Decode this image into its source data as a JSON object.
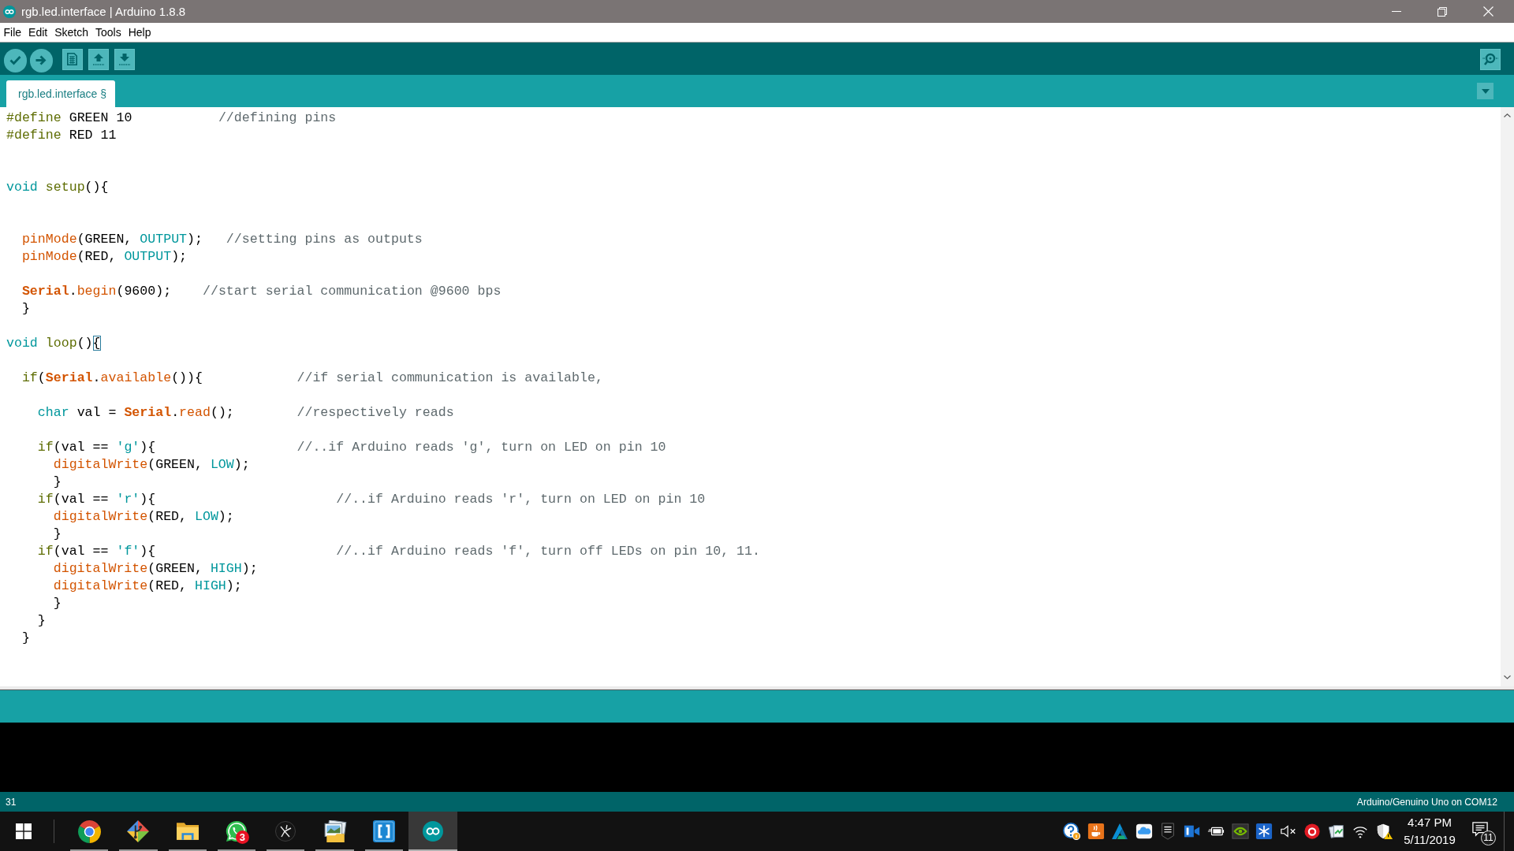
{
  "window": {
    "title": "rgb.led.interface | Arduino 1.8.8"
  },
  "menu": [
    "File",
    "Edit",
    "Sketch",
    "Tools",
    "Help"
  ],
  "tabs": [
    {
      "label": "rgb.led.interface §",
      "selected": true
    }
  ],
  "editor": {
    "lines": [
      {
        "kind": "code",
        "tokens": [
          {
            "text": "#define",
            "kind": "preprocessor"
          },
          {
            "text": " GREEN 10",
            "kind": "plain"
          },
          {
            "text": "           //defining pins",
            "kind": "comment"
          }
        ]
      },
      {
        "kind": "code",
        "tokens": [
          {
            "text": "#define",
            "kind": "preprocessor"
          },
          {
            "text": " RED 11",
            "kind": "plain"
          }
        ]
      },
      {
        "kind": "blank"
      },
      {
        "kind": "blank"
      },
      {
        "kind": "code",
        "tokens": [
          {
            "text": "void",
            "kind": "keyword"
          },
          {
            "text": " setup",
            "kind": "structure"
          },
          {
            "text": "(){",
            "kind": "plain"
          }
        ],
        "children": [
          {
            "kind": "blank"
          },
          {
            "kind": "blank"
          },
          {
            "kind": "code",
            "tokens": [
              {
                "text": "pinMode",
                "kind": "function"
              },
              {
                "text": "(GREEN, ",
                "kind": "plain"
              },
              {
                "text": "OUTPUT",
                "kind": "keyword"
              },
              {
                "text": ");",
                "kind": "plain"
              },
              {
                "text": "   //setting pins as outputs",
                "kind": "comment"
              }
            ]
          },
          {
            "kind": "code",
            "tokens": [
              {
                "text": "pinMode",
                "kind": "function"
              },
              {
                "text": "(RED, ",
                "kind": "plain"
              },
              {
                "text": "OUTPUT",
                "kind": "keyword"
              },
              {
                "text": ");",
                "kind": "plain"
              }
            ]
          },
          {
            "kind": "blank"
          },
          {
            "kind": "code",
            "tokens": [
              {
                "text": "Serial",
                "kind": "serial"
              },
              {
                "text": ".",
                "kind": "plain"
              },
              {
                "text": "begin",
                "kind": "function"
              },
              {
                "text": "(9600);",
                "kind": "plain"
              },
              {
                "text": "    //start serial communication @9600 bps",
                "kind": "comment"
              }
            ]
          },
          {
            "kind": "code",
            "tokens": [
              {
                "text": "}",
                "kind": "plain"
              }
            ]
          }
        ]
      },
      {
        "kind": "blank"
      },
      {
        "kind": "code",
        "tokens": [
          {
            "text": "void",
            "kind": "keyword"
          },
          {
            "text": " loop",
            "kind": "structure"
          },
          {
            "text": "()",
            "kind": "plain"
          },
          {
            "text": "{",
            "kind": "brace_match"
          }
        ],
        "children": [
          {
            "kind": "blank"
          },
          {
            "kind": "code",
            "tokens": [
              {
                "text": "if",
                "kind": "structure"
              },
              {
                "text": "(",
                "kind": "plain"
              },
              {
                "text": "Serial",
                "kind": "serial"
              },
              {
                "text": ".",
                "kind": "plain"
              },
              {
                "text": "available",
                "kind": "function"
              },
              {
                "text": "()){",
                "kind": "plain"
              },
              {
                "text": "            //if serial communication is available,",
                "kind": "comment"
              }
            ],
            "children": [
              {
                "kind": "blank"
              },
              {
                "kind": "code",
                "tokens": [
                  {
                    "text": "char",
                    "kind": "keyword"
                  },
                  {
                    "text": " val = ",
                    "kind": "plain"
                  },
                  {
                    "text": "Serial",
                    "kind": "serial"
                  },
                  {
                    "text": ".",
                    "kind": "plain"
                  },
                  {
                    "text": "read",
                    "kind": "function"
                  },
                  {
                    "text": "();",
                    "kind": "plain"
                  },
                  {
                    "text": "        //respectively reads",
                    "kind": "comment"
                  }
                ]
              },
              {
                "kind": "blank"
              },
              {
                "kind": "code",
                "tokens": [
                  {
                    "text": "if",
                    "kind": "structure"
                  },
                  {
                    "text": "(val == ",
                    "kind": "plain"
                  },
                  {
                    "text": "'g'",
                    "kind": "literal"
                  },
                  {
                    "text": "){",
                    "kind": "plain"
                  },
                  {
                    "text": "                  //..if Arduino reads 'g', turn on LED on pin 10",
                    "kind": "comment"
                  }
                ],
                "children": [
                  {
                    "kind": "code",
                    "tokens": [
                      {
                        "text": "digitalWrite",
                        "kind": "function"
                      },
                      {
                        "text": "(GREEN, ",
                        "kind": "plain"
                      },
                      {
                        "text": "LOW",
                        "kind": "keyword"
                      },
                      {
                        "text": ");",
                        "kind": "plain"
                      }
                    ]
                  },
                  {
                    "kind": "code",
                    "tokens": [
                      {
                        "text": "}",
                        "kind": "plain"
                      }
                    ]
                  }
                ]
              },
              {
                "kind": "code",
                "tokens": [
                  {
                    "text": "if",
                    "kind": "structure"
                  },
                  {
                    "text": "(val == ",
                    "kind": "plain"
                  },
                  {
                    "text": "'r'",
                    "kind": "literal"
                  },
                  {
                    "text": "){",
                    "kind": "plain"
                  },
                  {
                    "text": "                       //..if Arduino reads 'r', turn on LED on pin 10",
                    "kind": "comment"
                  }
                ],
                "children": [
                  {
                    "kind": "code",
                    "tokens": [
                      {
                        "text": "digitalWrite",
                        "kind": "function"
                      },
                      {
                        "text": "(RED, ",
                        "kind": "plain"
                      },
                      {
                        "text": "LOW",
                        "kind": "keyword"
                      },
                      {
                        "text": ");",
                        "kind": "plain"
                      }
                    ]
                  },
                  {
                    "kind": "code",
                    "tokens": [
                      {
                        "text": "}",
                        "kind": "plain"
                      }
                    ]
                  }
                ]
              },
              {
                "kind": "code",
                "tokens": [
                  {
                    "text": "if",
                    "kind": "structure"
                  },
                  {
                    "text": "(val == ",
                    "kind": "plain"
                  },
                  {
                    "text": "'f'",
                    "kind": "literal"
                  },
                  {
                    "text": "){",
                    "kind": "plain"
                  },
                  {
                    "text": "                       //..if Arduino reads 'f', turn off LEDs on pin 10, 11.",
                    "kind": "comment"
                  }
                ],
                "children": [
                  {
                    "kind": "code",
                    "tokens": [
                      {
                        "text": "digitalWrite",
                        "kind": "function"
                      },
                      {
                        "text": "(GREEN, ",
                        "kind": "plain"
                      },
                      {
                        "text": "HIGH",
                        "kind": "keyword"
                      },
                      {
                        "text": ");",
                        "kind": "plain"
                      }
                    ]
                  },
                  {
                    "kind": "code",
                    "tokens": [
                      {
                        "text": "digitalWrite",
                        "kind": "function"
                      },
                      {
                        "text": "(RED, ",
                        "kind": "plain"
                      },
                      {
                        "text": "HIGH",
                        "kind": "keyword"
                      },
                      {
                        "text": ");",
                        "kind": "plain"
                      }
                    ]
                  },
                  {
                    "kind": "code",
                    "tokens": [
                      {
                        "text": "}",
                        "kind": "plain"
                      }
                    ]
                  }
                ]
              },
              {
                "kind": "code",
                "tokens": [
                  {
                    "text": "}",
                    "kind": "plain"
                  }
                ]
              }
            ]
          },
          {
            "kind": "code",
            "tokens": [
              {
                "text": "}",
                "kind": "plain"
              }
            ]
          }
        ]
      }
    ]
  },
  "status_bar": {
    "line": "31",
    "board": "Arduino/Genuino Uno on COM12"
  },
  "taskbar": {
    "apps": [
      {
        "kind": "pinwheel",
        "running": true,
        "selected": false
      },
      {
        "kind": "diamond",
        "running": true,
        "selected": false
      },
      {
        "kind": "folder",
        "running": true,
        "selected": false
      },
      {
        "kind": "chat",
        "running": true,
        "selected": false,
        "badge": "3"
      },
      {
        "kind": "emblem",
        "running": true,
        "selected": false
      },
      {
        "kind": "pictures",
        "running": true,
        "selected": false
      },
      {
        "kind": "brackets",
        "running": true,
        "selected": false
      },
      {
        "kind": "infinity",
        "running": true,
        "selected": true
      }
    ],
    "clock": {
      "time": "4:47 PM",
      "date": "5/11/2019"
    },
    "notifications": {
      "count": "11"
    }
  }
}
